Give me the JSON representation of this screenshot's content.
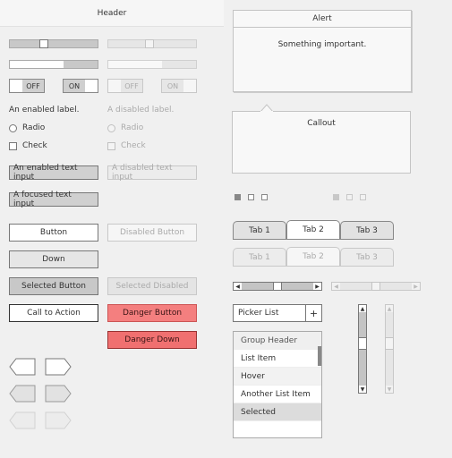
{
  "header": {
    "title": "Header"
  },
  "sliders": [
    {
      "value": 0.38,
      "enabled": true,
      "light": false
    },
    {
      "value": 0.47,
      "enabled": false,
      "light": false
    },
    {
      "value": 0.61,
      "enabled": true,
      "light": true
    },
    {
      "value": 0.61,
      "enabled": false,
      "light": true
    }
  ],
  "toggles": {
    "enabled_off": "OFF",
    "enabled_on": "ON",
    "disabled_off": "OFF",
    "disabled_on": "ON"
  },
  "labels": {
    "enabled": "An enabled label.",
    "disabled": "A disabled label.",
    "radio": "Radio",
    "check": "Check"
  },
  "text_inputs": {
    "enabled": "An enabled text input",
    "disabled": "A disabled text input",
    "focused": "A focused text input"
  },
  "buttons": {
    "button": "Button",
    "disabled": "Disabled Button",
    "down": "Down",
    "selected": "Selected Button",
    "selected_disabled": "Selected Disabled",
    "call_to_action": "Call to Action",
    "danger": "Danger Button",
    "danger_down": "Danger Down"
  },
  "alert": {
    "title": "Alert",
    "message": "Something important."
  },
  "callout": {
    "title": "Callout"
  },
  "page_indicators": {
    "enabled": {
      "count": 3,
      "current": 1
    },
    "disabled": {
      "count": 3,
      "current": 1
    }
  },
  "tabs": {
    "enabled": [
      "Tab 1",
      "Tab 2",
      "Tab 3"
    ],
    "disabled": [
      "Tab 1",
      "Tab 2",
      "Tab 3"
    ],
    "active_index": 1
  },
  "scrollbars": {
    "horizontal_enabled": {
      "position": 0.5
    },
    "horizontal_disabled": {
      "position": 0.5
    },
    "vertical_enabled": {
      "position": 0.5
    },
    "vertical_disabled": {
      "position": 0.5
    }
  },
  "picker": {
    "value": "Picker List",
    "add_symbol": "+"
  },
  "list": {
    "group_header": "Group Header",
    "items": [
      "List Item",
      "Hover",
      "Another List Item",
      "Selected"
    ]
  },
  "colors": {
    "danger": "#f47f7f",
    "selected": "#c8c8c8",
    "background": "#f0f0f0"
  },
  "icons": {
    "left_arrow": "triangle-left-icon",
    "right_arrow": "triangle-right-icon",
    "up_arrow": "triangle-up-icon",
    "down_arrow": "triangle-down-icon"
  }
}
